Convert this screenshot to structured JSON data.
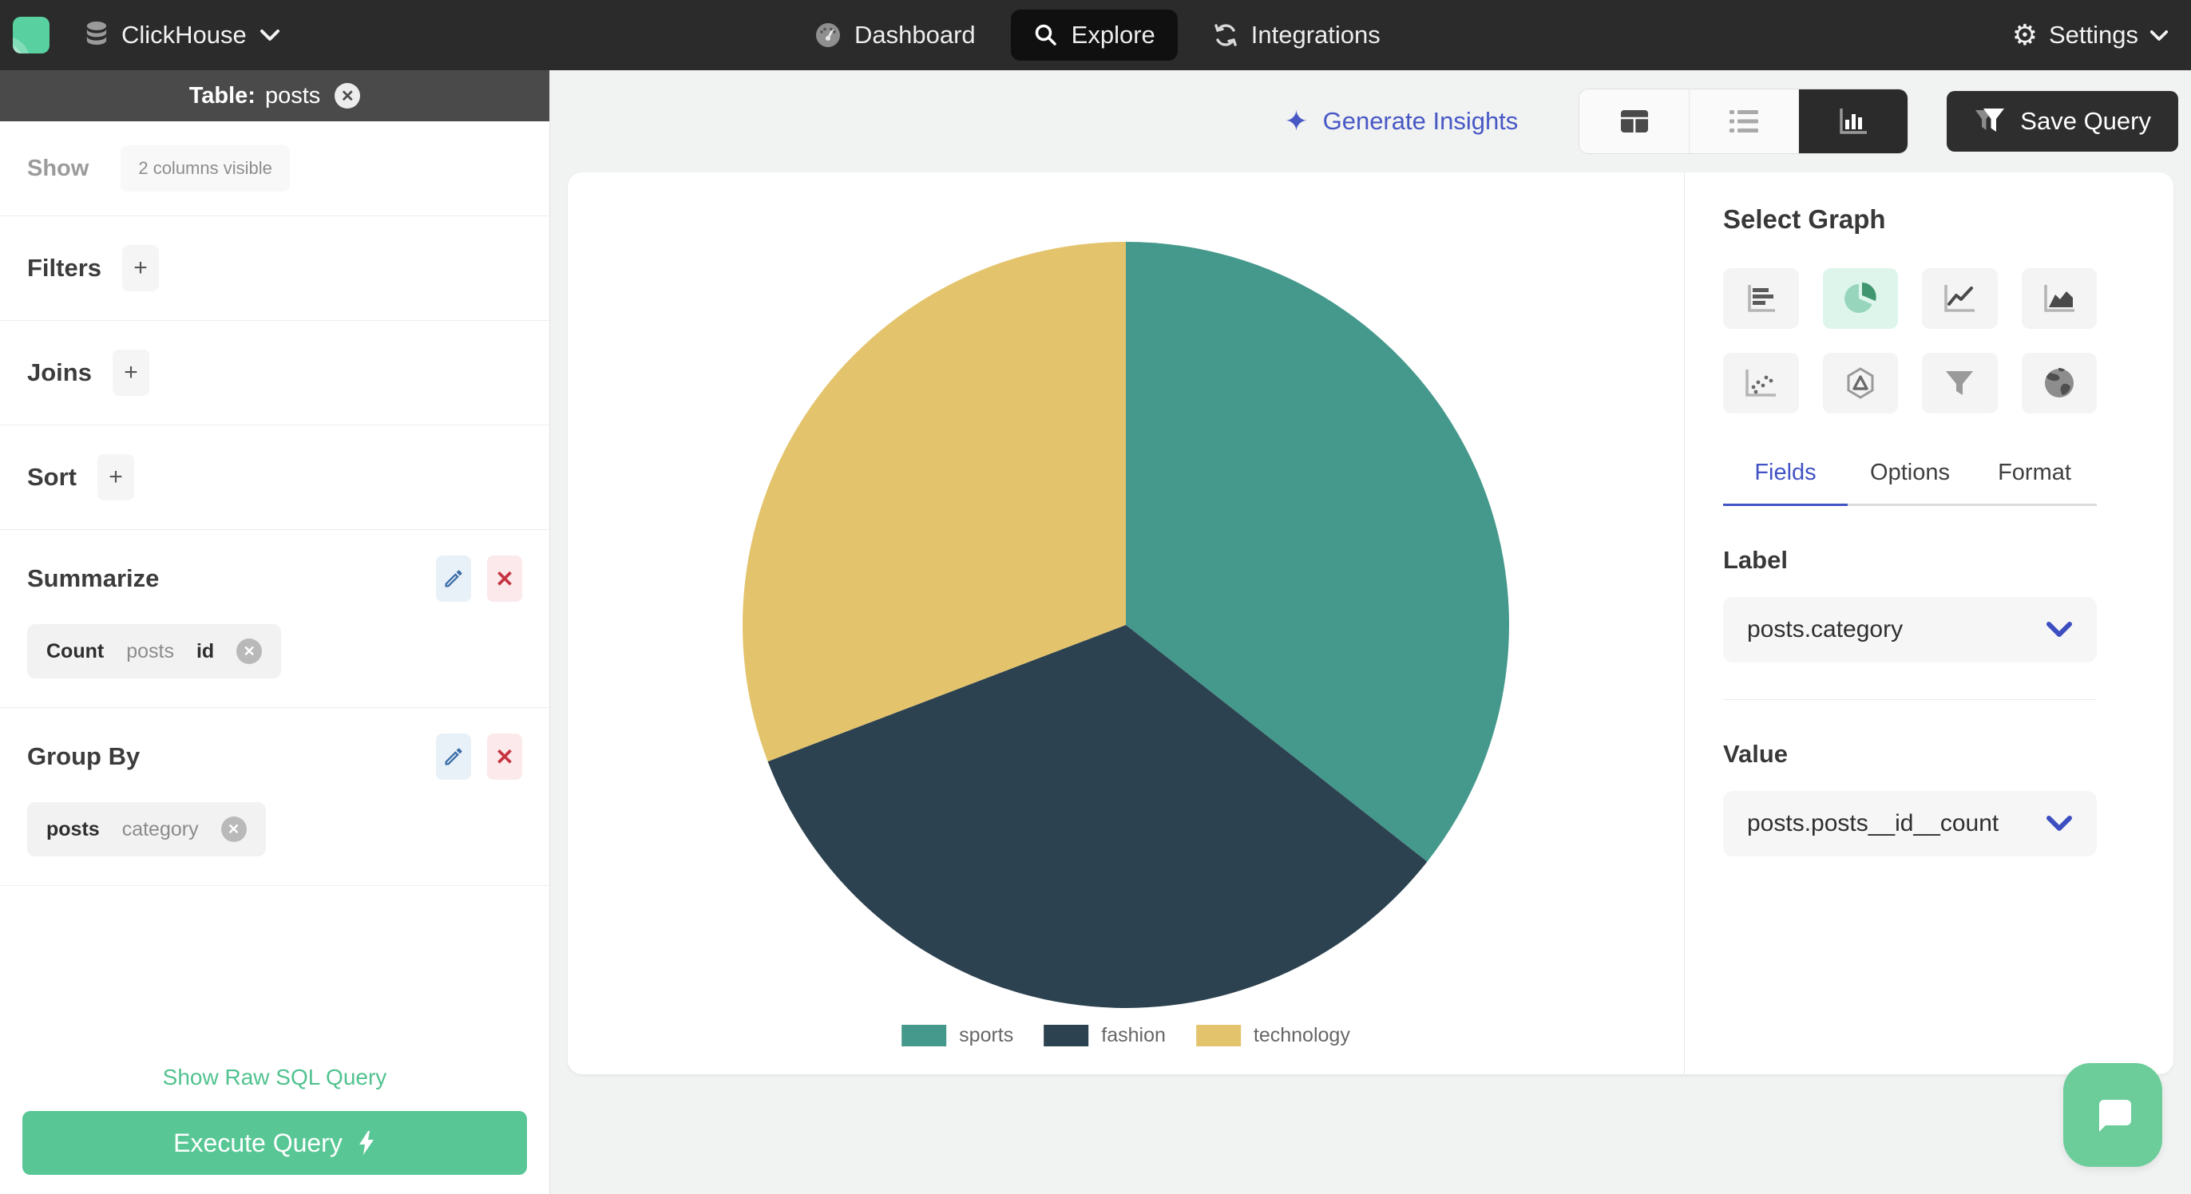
{
  "navbar": {
    "brand": "ClickHouse",
    "items": [
      {
        "label": "Dashboard",
        "icon": "gauge-icon"
      },
      {
        "label": "Explore",
        "icon": "search-icon",
        "active": true
      },
      {
        "label": "Integrations",
        "icon": "sync-icon"
      }
    ],
    "settings_label": "Settings"
  },
  "sidebar": {
    "table_label": "Table:",
    "table_name": "posts",
    "show_label": "Show",
    "show_chip": "2 columns visible",
    "sections": [
      {
        "label": "Filters",
        "add_label": "+"
      },
      {
        "label": "Joins",
        "add_label": "+"
      },
      {
        "label": "Sort",
        "add_label": "+"
      }
    ],
    "summarize": {
      "title": "Summarize",
      "chip": [
        "Count",
        "posts",
        "id"
      ]
    },
    "group_by": {
      "title": "Group By",
      "chip": [
        "posts",
        "category"
      ]
    },
    "raw_sql_label": "Show Raw SQL Query",
    "execute_label": "Execute Query"
  },
  "toolbar": {
    "insights_label": "Generate Insights",
    "save_label": "Save Query",
    "views": [
      "table",
      "list",
      "chart"
    ],
    "active_view": "chart"
  },
  "panel": {
    "title": "Select Graph",
    "graph_types": [
      "bar",
      "pie",
      "line",
      "area",
      "scatter",
      "radar",
      "funnel",
      "map"
    ],
    "active_graph": "pie",
    "tabs": [
      "Fields",
      "Options",
      "Format"
    ],
    "active_tab": "Fields",
    "label_heading": "Label",
    "label_value": "posts.category",
    "value_heading": "Value",
    "value_value": "posts.posts__id__count"
  },
  "chart_data": {
    "type": "pie",
    "categories": [
      "sports",
      "fashion",
      "technology"
    ],
    "values": [
      35.6,
      33.6,
      30.8
    ],
    "unit": "percent (estimated from slice angles)",
    "colors": [
      "#45998c",
      "#2c4250",
      "#e3c46d"
    ],
    "title": "",
    "legend_position": "bottom",
    "start_angle_deg": 0,
    "direction": "clockwise"
  },
  "colors": {
    "accent_green": "#58c795",
    "accent_blue": "#4253c4",
    "navbar_bg": "#2b2b2b",
    "table_bar_bg": "#4a4a4a",
    "active_graph_bg": "#ddf5ea",
    "edit_blue": "#3a6ea8",
    "delete_red": "#c63340"
  }
}
